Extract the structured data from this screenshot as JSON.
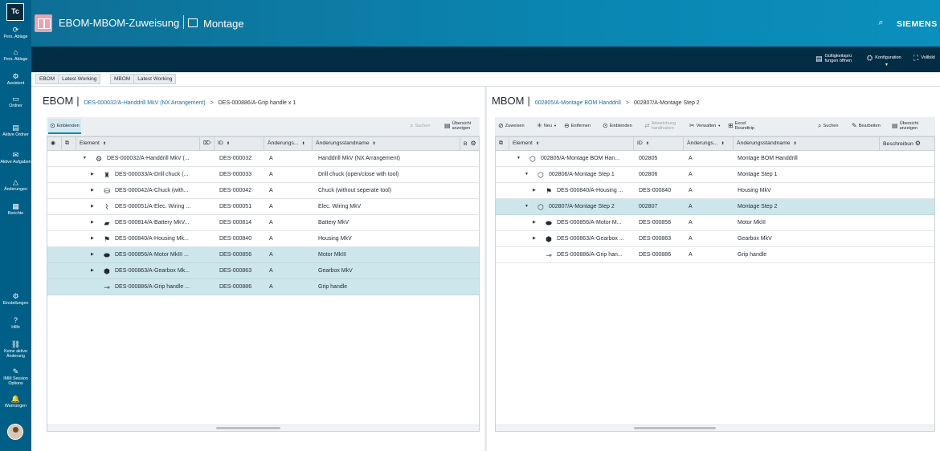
{
  "rail": {
    "logo": "Tc",
    "items": [
      {
        "icon": "refresh-icon",
        "glyph": "⟳",
        "label": "Pers. Ablage"
      },
      {
        "icon": "home-icon",
        "glyph": "⌂",
        "label": "Pers. Ablage"
      },
      {
        "icon": "assistant-icon",
        "glyph": "⚙",
        "label": "Assistent"
      },
      {
        "icon": "folder-icon",
        "glyph": "▭",
        "label": "Ordner"
      },
      {
        "icon": "active-folder-icon",
        "glyph": "▤",
        "label": "Aktive Ordner"
      },
      {
        "icon": "inbox-icon",
        "glyph": "✉",
        "label": "Aktive Aufgaben"
      },
      {
        "icon": "changes-icon",
        "glyph": "△",
        "label": "Änderungen"
      },
      {
        "icon": "report-icon",
        "glyph": "▦",
        "label": "Berichte"
      },
      {
        "icon": "settings-icon",
        "glyph": "⚙",
        "label": "Einstellungen"
      },
      {
        "icon": "help-icon",
        "glyph": "?",
        "label": "Hilfe"
      },
      {
        "icon": "no-change-icon",
        "glyph": "⛓",
        "label": "Keine aktive Änderung"
      },
      {
        "icon": "session-icon",
        "glyph": "✎",
        "label": "IMM Session Options"
      },
      {
        "icon": "bell-icon",
        "glyph": "🔔",
        "label": "Warnungen"
      }
    ]
  },
  "header": {
    "title": "EBOM-MBOM-Zuweisung",
    "context": "Montage",
    "brand": "SIEMENS"
  },
  "darkbar": {
    "validity": "Gültigkeitsprü fungen öffnen",
    "config": "Konfiguration",
    "fullscreen": "Vollbild"
  },
  "revision": {
    "ebom_label": "EBOM",
    "ebom_rule": "Latest Working",
    "mbom_label": "MBOM",
    "mbom_rule": "Latest Working"
  },
  "ebom": {
    "title": "EBOM",
    "crumb": "DES-000032/A-Handdrill MkV (NX Arrangement)",
    "sep": ">",
    "crumb2": "DES-000886/A-Grip handle x 1",
    "toolbar": {
      "show": "Einblenden",
      "search": "Suchen",
      "overview": "Übersicht anzeigen"
    },
    "columns": {
      "element": "Element",
      "id": "ID",
      "change": "Änderungs...",
      "revname": "Änderungsstandname",
      "extra": "B"
    },
    "rows": [
      {
        "level": 0,
        "twist": "▼",
        "icon": "assembly-icon",
        "glyph": "⚙",
        "element": "DES-000032/A-Handdrill MkV (...",
        "id": "DES-000032",
        "change": "A",
        "revname": "Handdrill MkV (NX Arrangement)",
        "selected": false
      },
      {
        "level": 1,
        "twist": "▶",
        "icon": "chuck-icon",
        "glyph": "♜",
        "element": "DES-000033/A-Drill chuck (...",
        "id": "DES-000033",
        "change": "A",
        "revname": "Drill chuck (open/close with tool)",
        "selected": false
      },
      {
        "level": 1,
        "twist": "▶",
        "icon": "chuck-part-icon",
        "glyph": "⛁",
        "element": "DES-000042/A-Chuck (with...",
        "id": "DES-000042",
        "change": "A",
        "revname": "Chuck (without seperate tool)",
        "selected": false
      },
      {
        "level": 1,
        "twist": "▶",
        "icon": "wiring-icon",
        "glyph": "⌇",
        "element": "DES-000051/A-Elec. Wiring ...",
        "id": "DES-000051",
        "change": "A",
        "revname": "Elec. Wiring MkV",
        "selected": false
      },
      {
        "level": 1,
        "twist": "▶",
        "icon": "battery-icon",
        "glyph": "▰",
        "element": "DES-000814/A-Battery MkV...",
        "id": "DES-000814",
        "change": "A",
        "revname": "Battery MkV",
        "selected": false
      },
      {
        "level": 1,
        "twist": "▶",
        "icon": "housing-icon",
        "glyph": "⚑",
        "element": "DES-000840/A-Housing Mk...",
        "id": "DES-000840",
        "change": "A",
        "revname": "Housing MkV",
        "selected": false
      },
      {
        "level": 1,
        "twist": "▶",
        "icon": "motor-icon",
        "glyph": "⬬",
        "element": "DES-000856/A-Motor MkIII ...",
        "id": "DES-000856",
        "change": "A",
        "revname": "Motor MkIII",
        "selected": true
      },
      {
        "level": 1,
        "twist": "▶",
        "icon": "gearbox-icon",
        "glyph": "⬢",
        "element": "DES-000863/A-Gearbox Mk...",
        "id": "DES-000863",
        "change": "A",
        "revname": "Gearbox MkV",
        "selected": true
      },
      {
        "level": 1,
        "twist": "",
        "icon": "grip-icon",
        "glyph": "⊸",
        "element": "DES-000886/A-Grip handle ...",
        "id": "DES-000886",
        "change": "A",
        "revname": "Grip handle",
        "selected": true
      }
    ]
  },
  "mbom": {
    "title": "MBOM",
    "crumb": "002805/A-Montage BOM Handdrill",
    "sep": ">",
    "crumb2": "002807/A-Montage Step 2",
    "toolbar": {
      "assign": "Zuweisen",
      "new": "Neu",
      "remove": "Entfernen",
      "show": "Einblenden",
      "deviation": "Abweichung handhaben",
      "manage": "Verwalten",
      "excel": "Excel Roundtrip",
      "search": "Suchen",
      "edit": "Bearbeiten",
      "overview": "Übersicht anzeigen"
    },
    "columns": {
      "element": "Element",
      "id": "ID",
      "change": "Änderungs...",
      "revname": "Änderungsstandname",
      "desc": "Beschreibun"
    },
    "rows": [
      {
        "level": 0,
        "twist": "▼",
        "icon": "process-icon",
        "glyph": "⬡",
        "element": "002805/A-Montage BOM Han...",
        "id": "002805",
        "change": "A",
        "revname": "Montage BOM Handdrill",
        "selected": false
      },
      {
        "level": 1,
        "twist": "▼",
        "icon": "process-icon",
        "glyph": "⬡",
        "element": "002806/A-Montage Step 1",
        "id": "002806",
        "change": "A",
        "revname": "Montage Step 1",
        "selected": false
      },
      {
        "level": 2,
        "twist": "▶",
        "icon": "housing-icon",
        "glyph": "⚑",
        "element": "DES-000840/A-Housing ...",
        "id": "DES-000840",
        "change": "A",
        "revname": "Housing MkV",
        "selected": false
      },
      {
        "level": 1,
        "twist": "▼",
        "icon": "process-icon",
        "glyph": "⬡",
        "element": "002807/A-Montage Step 2",
        "id": "002807",
        "change": "A",
        "revname": "Montage Step 2",
        "selected": true
      },
      {
        "level": 2,
        "twist": "▶",
        "icon": "motor-icon",
        "glyph": "⬬",
        "element": "DES-000856/A-Motor M...",
        "id": "DES-000856",
        "change": "A",
        "revname": "Motor MkIII",
        "selected": false
      },
      {
        "level": 2,
        "twist": "▶",
        "icon": "gearbox-icon",
        "glyph": "⬢",
        "element": "DES-000863/A-Gearbox ...",
        "id": "DES-000863",
        "change": "A",
        "revname": "Gearbox MkV",
        "selected": false
      },
      {
        "level": 2,
        "twist": "",
        "icon": "grip-icon",
        "glyph": "⊸",
        "element": "DES-000886/A-Grip han...",
        "id": "DES-000886",
        "change": "A",
        "revname": "Grip handle",
        "selected": false
      }
    ]
  }
}
